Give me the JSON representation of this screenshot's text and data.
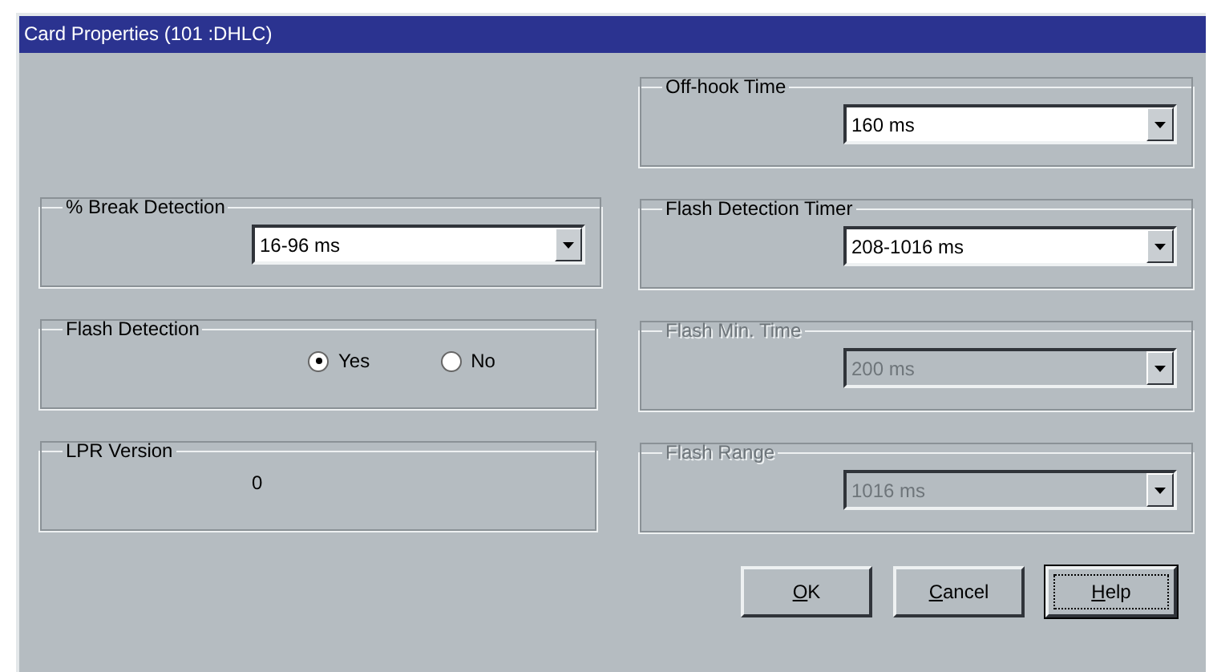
{
  "window": {
    "title": "Card Properties (101 :DHLC)"
  },
  "left_groups": [
    {
      "kind": "dropdown",
      "label": "% Break Detection",
      "value": "16-96 ms",
      "disabled": false
    },
    {
      "kind": "radio",
      "label": "Flash Detection",
      "options": [
        {
          "label": "Yes",
          "selected": true
        },
        {
          "label": "No",
          "selected": false
        }
      ]
    },
    {
      "kind": "value",
      "label": "LPR Version",
      "value": "0"
    }
  ],
  "right_groups": [
    {
      "kind": "dropdown",
      "label": "Off-hook Time",
      "value": "160 ms",
      "disabled": false
    },
    {
      "kind": "dropdown",
      "label": "Flash Detection Timer",
      "value": "208-1016 ms",
      "disabled": false
    },
    {
      "kind": "dropdown",
      "label": "Flash Min. Time",
      "value": "200 ms",
      "disabled": true
    },
    {
      "kind": "dropdown",
      "label": "Flash Range",
      "value": "1016 ms",
      "disabled": true
    }
  ],
  "buttons": [
    {
      "label": "OK",
      "focused": false
    },
    {
      "label": "Cancel",
      "focused": false
    },
    {
      "label": "Help",
      "focused": true
    }
  ]
}
